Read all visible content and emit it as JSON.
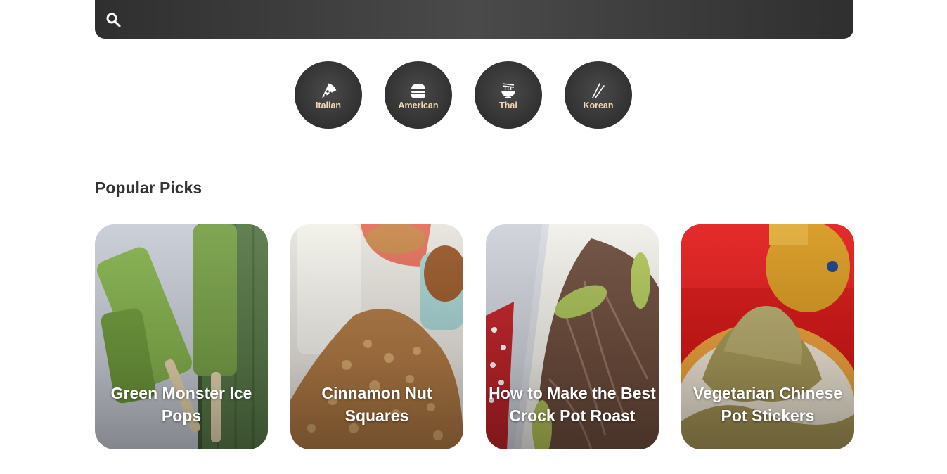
{
  "search": {
    "icon": "search-icon"
  },
  "cuisines": [
    {
      "label": "Italian",
      "icon": "pizza-icon"
    },
    {
      "label": "American",
      "icon": "burger-icon"
    },
    {
      "label": "Thai",
      "icon": "noodle-bowl-icon"
    },
    {
      "label": "Korean",
      "icon": "chopsticks-icon"
    }
  ],
  "popular": {
    "title": "Popular Picks",
    "cards": [
      {
        "title": "Green Monster Ice Pops"
      },
      {
        "title": "Cinnamon Nut Squares"
      },
      {
        "title": "How to Make the Best Crock Pot Roast"
      },
      {
        "title": "Vegetarian Chinese Pot Stickers"
      }
    ]
  },
  "colors": {
    "accent_text": "#f1d9b5",
    "dark": "#3a3a3a"
  }
}
